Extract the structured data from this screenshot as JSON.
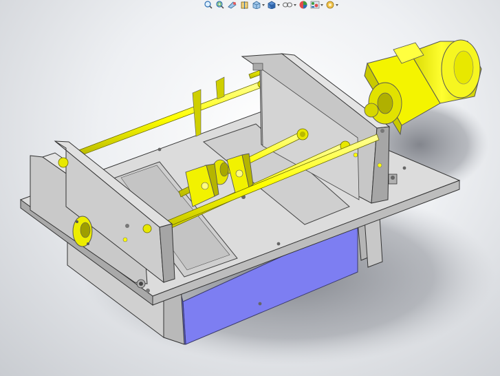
{
  "app": {
    "viewport_background": [
      "#ffffff",
      "#c9ccd1"
    ]
  },
  "hud_toolbar": {
    "buttons": [
      {
        "name": "zoom-to-fit",
        "icon": "zoom-to-fit-icon"
      },
      {
        "name": "zoom-to-area",
        "icon": "zoom-to-area-icon"
      },
      {
        "name": "previous-view",
        "icon": "previous-view-icon"
      },
      {
        "name": "section-view",
        "icon": "section-view-icon"
      },
      {
        "name": "view-orientation",
        "icon": "view-orientation-icon",
        "dropdown": true
      },
      {
        "name": "display-style",
        "icon": "display-style-icon",
        "dropdown": true
      },
      {
        "name": "hide-show-items",
        "icon": "hide-show-items-icon",
        "dropdown": true
      },
      {
        "name": "edit-appearance",
        "icon": "edit-appearance-icon"
      },
      {
        "name": "apply-scene",
        "icon": "apply-scene-icon",
        "dropdown": true
      },
      {
        "name": "view-settings",
        "icon": "view-settings-icon",
        "dropdown": true
      }
    ]
  },
  "model": {
    "parts": [
      "base-plate",
      "left-side-plate",
      "right-side-plate",
      "hopper",
      "guide-rods",
      "lead-screw",
      "coupling",
      "bearing-blocks",
      "gear-motor"
    ],
    "colors": {
      "plate": "#c9c9c9",
      "plate_light": "#e2e2e2",
      "plate_dark": "#9d9d9d",
      "hopper": "#7f80f4",
      "hopper_dark": "#5d5ed8",
      "yellow": "#ffff00",
      "yellow_dark": "#b7b700",
      "shadow": "#7a7d85"
    }
  }
}
